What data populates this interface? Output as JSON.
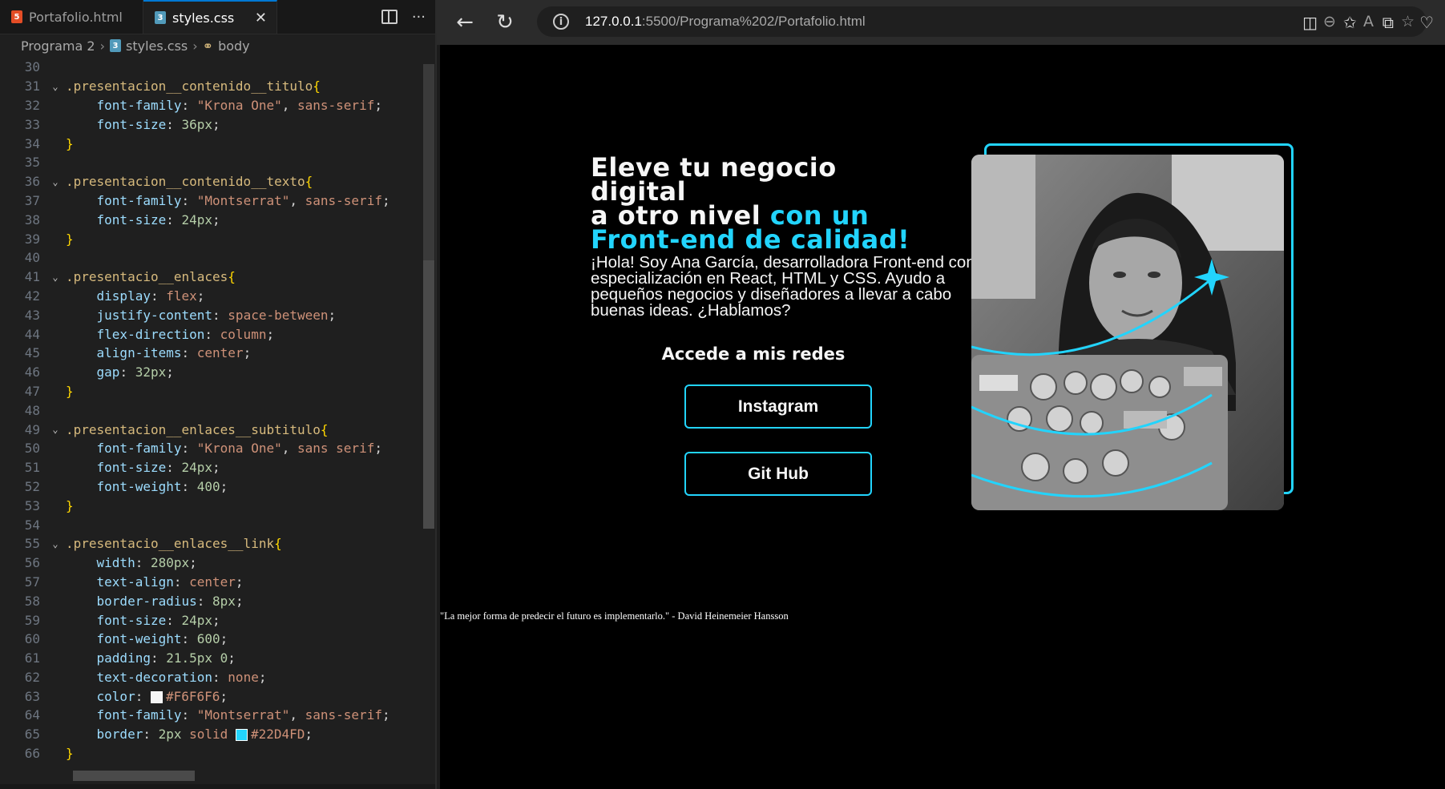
{
  "editor": {
    "tabs": [
      {
        "label": "Portafolio.html",
        "icon": "html5-icon"
      },
      {
        "label": "styles.css",
        "icon": "css-icon"
      }
    ],
    "breadcrumb": [
      "Programa 2",
      "styles.css",
      "body"
    ],
    "lines": [
      {
        "n": "30",
        "tokens": []
      },
      {
        "n": "31",
        "fold": true,
        "tokens": [
          [
            "sel",
            ".presentacion__contenido__titulo"
          ],
          [
            "brace",
            "{"
          ]
        ]
      },
      {
        "n": "32",
        "tokens": [
          [
            "sp",
            "    "
          ],
          [
            "prop",
            "font-family"
          ],
          [
            "punc",
            ": "
          ],
          [
            "val",
            "\"Krona One\""
          ],
          [
            "punc",
            ", "
          ],
          [
            "val",
            "sans-serif"
          ],
          [
            "punc",
            ";"
          ]
        ]
      },
      {
        "n": "33",
        "tokens": [
          [
            "sp",
            "    "
          ],
          [
            "prop",
            "font-size"
          ],
          [
            "punc",
            ": "
          ],
          [
            "num",
            "36px"
          ],
          [
            "punc",
            ";"
          ]
        ]
      },
      {
        "n": "34",
        "tokens": [
          [
            "brace",
            "}"
          ]
        ]
      },
      {
        "n": "35",
        "tokens": []
      },
      {
        "n": "36",
        "fold": true,
        "tokens": [
          [
            "sel",
            ".presentacion__contenido__texto"
          ],
          [
            "brace",
            "{"
          ]
        ]
      },
      {
        "n": "37",
        "tokens": [
          [
            "sp",
            "    "
          ],
          [
            "prop",
            "font-family"
          ],
          [
            "punc",
            ": "
          ],
          [
            "val",
            "\"Montserrat\""
          ],
          [
            "punc",
            ", "
          ],
          [
            "val",
            "sans-serif"
          ],
          [
            "punc",
            ";"
          ]
        ]
      },
      {
        "n": "38",
        "tokens": [
          [
            "sp",
            "    "
          ],
          [
            "prop",
            "font-size"
          ],
          [
            "punc",
            ": "
          ],
          [
            "num",
            "24px"
          ],
          [
            "punc",
            ";"
          ]
        ]
      },
      {
        "n": "39",
        "tokens": [
          [
            "brace",
            "}"
          ]
        ]
      },
      {
        "n": "40",
        "tokens": []
      },
      {
        "n": "41",
        "fold": true,
        "tokens": [
          [
            "sel",
            ".presentacio__enlaces"
          ],
          [
            "brace",
            "{"
          ]
        ]
      },
      {
        "n": "42",
        "tokens": [
          [
            "sp",
            "    "
          ],
          [
            "prop",
            "display"
          ],
          [
            "punc",
            ": "
          ],
          [
            "val",
            "flex"
          ],
          [
            "punc",
            ";"
          ]
        ]
      },
      {
        "n": "43",
        "tokens": [
          [
            "sp",
            "    "
          ],
          [
            "prop",
            "justify-content"
          ],
          [
            "punc",
            ": "
          ],
          [
            "val",
            "space-between"
          ],
          [
            "punc",
            ";"
          ]
        ]
      },
      {
        "n": "44",
        "tokens": [
          [
            "sp",
            "    "
          ],
          [
            "prop",
            "flex-direction"
          ],
          [
            "punc",
            ": "
          ],
          [
            "val",
            "column"
          ],
          [
            "punc",
            ";"
          ]
        ]
      },
      {
        "n": "45",
        "tokens": [
          [
            "sp",
            "    "
          ],
          [
            "prop",
            "align-items"
          ],
          [
            "punc",
            ": "
          ],
          [
            "val",
            "center"
          ],
          [
            "punc",
            ";"
          ]
        ]
      },
      {
        "n": "46",
        "tokens": [
          [
            "sp",
            "    "
          ],
          [
            "prop",
            "gap"
          ],
          [
            "punc",
            ": "
          ],
          [
            "num",
            "32px"
          ],
          [
            "punc",
            ";"
          ]
        ]
      },
      {
        "n": "47",
        "tokens": [
          [
            "brace",
            "}"
          ]
        ]
      },
      {
        "n": "48",
        "tokens": []
      },
      {
        "n": "49",
        "fold": true,
        "tokens": [
          [
            "sel",
            ".presentacion__enlaces__subtitulo"
          ],
          [
            "brace",
            "{"
          ]
        ]
      },
      {
        "n": "50",
        "tokens": [
          [
            "sp",
            "    "
          ],
          [
            "prop",
            "font-family"
          ],
          [
            "punc",
            ": "
          ],
          [
            "val",
            "\"Krona One\""
          ],
          [
            "punc",
            ", "
          ],
          [
            "val",
            "sans serif"
          ],
          [
            "punc",
            ";"
          ]
        ]
      },
      {
        "n": "51",
        "tokens": [
          [
            "sp",
            "    "
          ],
          [
            "prop",
            "font-size"
          ],
          [
            "punc",
            ": "
          ],
          [
            "num",
            "24px"
          ],
          [
            "punc",
            ";"
          ]
        ]
      },
      {
        "n": "52",
        "tokens": [
          [
            "sp",
            "    "
          ],
          [
            "prop",
            "font-weight"
          ],
          [
            "punc",
            ": "
          ],
          [
            "num",
            "400"
          ],
          [
            "punc",
            ";"
          ]
        ]
      },
      {
        "n": "53",
        "tokens": [
          [
            "brace",
            "}"
          ]
        ]
      },
      {
        "n": "54",
        "tokens": []
      },
      {
        "n": "55",
        "fold": true,
        "tokens": [
          [
            "sel",
            ".presentacio__enlaces__link"
          ],
          [
            "brace",
            "{"
          ]
        ]
      },
      {
        "n": "56",
        "tokens": [
          [
            "sp",
            "    "
          ],
          [
            "prop",
            "width"
          ],
          [
            "punc",
            ": "
          ],
          [
            "num",
            "280px"
          ],
          [
            "punc",
            ";"
          ]
        ]
      },
      {
        "n": "57",
        "tokens": [
          [
            "sp",
            "    "
          ],
          [
            "prop",
            "text-align"
          ],
          [
            "punc",
            ": "
          ],
          [
            "val",
            "center"
          ],
          [
            "punc",
            ";"
          ]
        ]
      },
      {
        "n": "58",
        "tokens": [
          [
            "sp",
            "    "
          ],
          [
            "prop",
            "border-radius"
          ],
          [
            "punc",
            ": "
          ],
          [
            "num",
            "8px"
          ],
          [
            "punc",
            ";"
          ]
        ]
      },
      {
        "n": "59",
        "tokens": [
          [
            "sp",
            "    "
          ],
          [
            "prop",
            "font-size"
          ],
          [
            "punc",
            ": "
          ],
          [
            "num",
            "24px"
          ],
          [
            "punc",
            ";"
          ]
        ]
      },
      {
        "n": "60",
        "tokens": [
          [
            "sp",
            "    "
          ],
          [
            "prop",
            "font-weight"
          ],
          [
            "punc",
            ": "
          ],
          [
            "num",
            "600"
          ],
          [
            "punc",
            ";"
          ]
        ]
      },
      {
        "n": "61",
        "tokens": [
          [
            "sp",
            "    "
          ],
          [
            "prop",
            "padding"
          ],
          [
            "punc",
            ": "
          ],
          [
            "num",
            "21.5px 0"
          ],
          [
            "punc",
            ";"
          ]
        ]
      },
      {
        "n": "62",
        "tokens": [
          [
            "sp",
            "    "
          ],
          [
            "prop",
            "text-decoration"
          ],
          [
            "punc",
            ": "
          ],
          [
            "val",
            "none"
          ],
          [
            "punc",
            ";"
          ]
        ]
      },
      {
        "n": "63",
        "tokens": [
          [
            "sp",
            "    "
          ],
          [
            "prop",
            "color"
          ],
          [
            "punc",
            ": "
          ],
          [
            "swatch",
            "#F6F6F6"
          ],
          [
            "val",
            "#F6F6F6"
          ],
          [
            "punc",
            ";"
          ]
        ]
      },
      {
        "n": "64",
        "tokens": [
          [
            "sp",
            "    "
          ],
          [
            "prop",
            "font-family"
          ],
          [
            "punc",
            ": "
          ],
          [
            "val",
            "\"Montserrat\""
          ],
          [
            "punc",
            ", "
          ],
          [
            "val",
            "sans-serif"
          ],
          [
            "punc",
            ";"
          ]
        ]
      },
      {
        "n": "65",
        "tokens": [
          [
            "sp",
            "    "
          ],
          [
            "prop",
            "border"
          ],
          [
            "punc",
            ": "
          ],
          [
            "num",
            "2px"
          ],
          [
            "punc",
            " "
          ],
          [
            "val",
            "solid"
          ],
          [
            "punc",
            " "
          ],
          [
            "swatch",
            "#22D4FD"
          ],
          [
            "val",
            "#22D4FD"
          ],
          [
            "punc",
            ";"
          ]
        ]
      },
      {
        "n": "66",
        "tokens": [
          [
            "brace",
            "}"
          ]
        ]
      }
    ]
  },
  "browser": {
    "url_host": "127.0.0.1",
    "url_path": ":5500/Programa%202/Portafolio.html"
  },
  "page": {
    "title_line1": "Eleve tu negocio digital",
    "title_line2_plain": "a otro nivel ",
    "title_line2_accent": "con un",
    "title_line3_accent": "Front-end de calidad!",
    "intro_text": "¡Hola! Soy Ana García, desarrolladora Front-end con especialización en React, HTML y CSS. Ayudo a pequeños negocios y diseñadores a llevar a cabo buenas ideas. ¿Hablamos?",
    "links_subtitle": "Accede a mis redes",
    "links": [
      "Instagram",
      "Git Hub"
    ],
    "quote": "\"La mejor forma de predecir el futuro es implementarlo.\" - David Heinemeier Hansson"
  },
  "colors": {
    "accent": "#22D4FD",
    "text": "#F6F6F6",
    "page_background": "#000000",
    "editor_background": "#1f1f1f"
  }
}
